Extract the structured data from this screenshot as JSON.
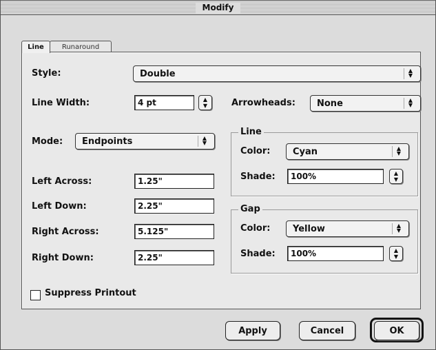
{
  "window": {
    "title": "Modify"
  },
  "tabs": {
    "active": "Line",
    "inactive": "Runaround"
  },
  "style": {
    "label": "Style:",
    "value": "Double"
  },
  "line_width": {
    "label": "Line Width:",
    "value": "4 pt"
  },
  "arrowheads": {
    "label": "Arrowheads:",
    "value": "None"
  },
  "mode": {
    "label": "Mode:",
    "value": "Endpoints"
  },
  "coords": {
    "left_across_label": "Left Across:",
    "left_across": "1.25\"",
    "left_down_label": "Left Down:",
    "left_down": "2.25\"",
    "right_across_label": "Right Across:",
    "right_across": "5.125\"",
    "right_down_label": "Right Down:",
    "right_down": "2.25\""
  },
  "line_group": {
    "title": "Line",
    "color_label": "Color:",
    "color": "Cyan",
    "shade_label": "Shade:",
    "shade": "100%"
  },
  "gap_group": {
    "title": "Gap",
    "color_label": "Color:",
    "color": "Yellow",
    "shade_label": "Shade:",
    "shade": "100%"
  },
  "suppress": {
    "label": "Suppress Printout",
    "checked": false
  },
  "buttons": {
    "apply": "Apply",
    "cancel": "Cancel",
    "ok": "OK"
  }
}
